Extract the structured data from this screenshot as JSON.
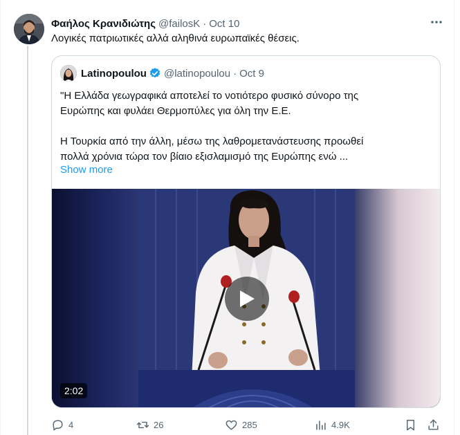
{
  "tweet": {
    "author_name": "Φαήλος Κρανιδιώτης",
    "handle": "@failosK",
    "separator": "·",
    "date": "Oct 10",
    "text": "Λογικές πατριωτικές αλλά αληθινά ευρωπαϊκές θέσεις."
  },
  "quote": {
    "author_name": "Latinopoulou",
    "handle": "@latinopoulou",
    "separator": "·",
    "date": "Oct 9",
    "lines": [
      "\"Η Ελλάδα γεωγραφικά αποτελεί το νοτιότερο φυσικό σύνορο της",
      "Ευρώπης και φυλάει Θερμοπύλες για όλη την Ε.Ε.",
      "Η Τουρκία από την άλλη, μέσω της λαθρομετανάστευσης προωθεί",
      "πολλά χρόνια τώρα τον βίαιο εξισλαμισμό της Ευρώπης ενώ ..."
    ],
    "show_more": "Show more",
    "video_duration": "2:02"
  },
  "actions": {
    "replies": "4",
    "retweets": "26",
    "likes": "285",
    "views": "4.9K"
  },
  "icons": {
    "more": "more-icon",
    "verified": "verified-badge-icon",
    "play": "play-icon",
    "reply": "reply-icon",
    "retweet": "retweet-icon",
    "like": "like-icon",
    "views": "views-icon",
    "bookmark": "bookmark-icon",
    "share": "share-icon"
  },
  "colors": {
    "link": "#1d9bf0",
    "secondary_text": "#536471",
    "border": "#cfd9de",
    "verified": "#1d9bf0"
  }
}
